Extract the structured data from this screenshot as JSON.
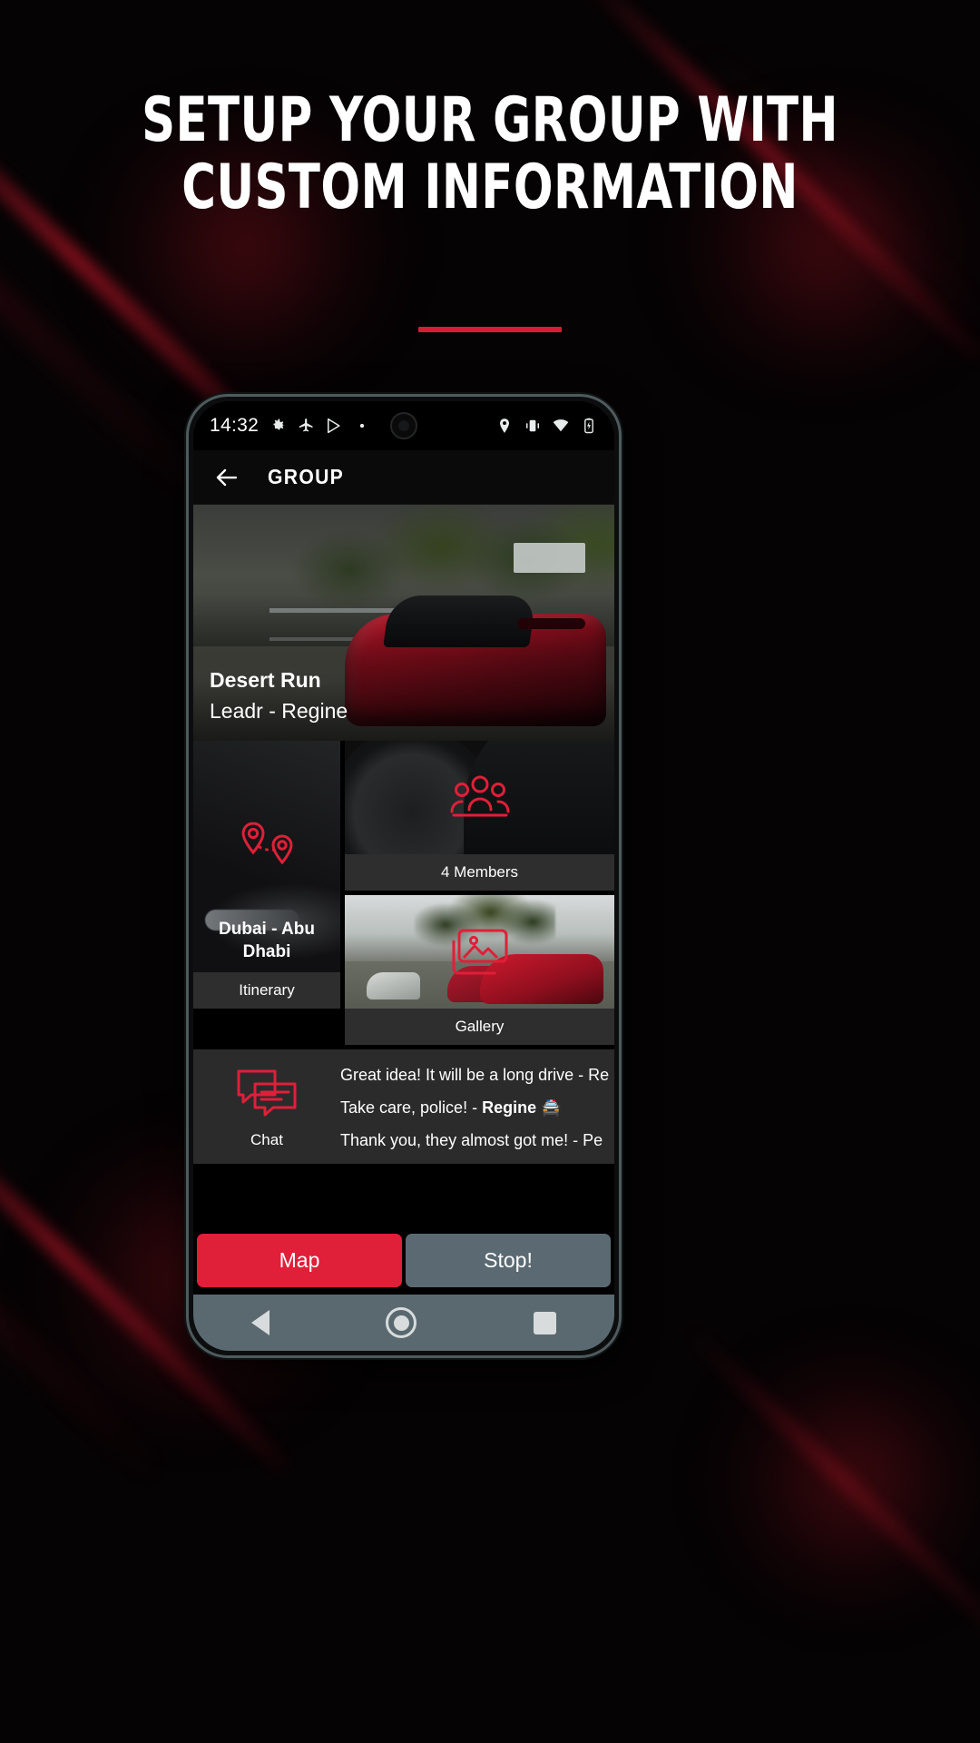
{
  "marketing": {
    "headline_line1": "SETUP YOUR GROUP WITH",
    "headline_line2": "CUSTOM INFORMATION",
    "accent_color": "#d21f35",
    "background_color": "#000000"
  },
  "phone": {
    "status_bar": {
      "time": "14:32",
      "left_icons": [
        "gear-icon",
        "airplane-icon",
        "play-store-icon",
        "dot-icon"
      ],
      "right_icons": [
        "location-icon",
        "vibrate-icon",
        "wifi-icon",
        "battery-icon"
      ]
    },
    "app_bar": {
      "back_label": "back-arrow",
      "title": "GROUP"
    },
    "hero": {
      "group_name": "Desert Run",
      "leader_line": "Leadr - Regine"
    },
    "tiles": [
      {
        "key": "itinerary",
        "icon": "map-pins-icon",
        "overlay_label": "Dubai - Abu Dhabi",
        "caption": "Itinerary"
      },
      {
        "key": "members",
        "icon": "members-group-icon",
        "caption": "4 Members"
      },
      {
        "key": "gallery",
        "icon": "photo-gallery-icon",
        "caption": "Gallery"
      }
    ],
    "chat": {
      "icon": "chat-bubbles-icon",
      "label": "Chat",
      "messages": [
        {
          "text": "Great idea! It will be a long drive - Re",
          "author_bold": false
        },
        {
          "text": "Take care, police! - ",
          "author": "Regine",
          "suffix": " 🚔",
          "author_bold": true
        },
        {
          "text": "Thank you, they almost got me! - Pe",
          "author_bold": false
        }
      ]
    },
    "actions": {
      "primary_label": "Map",
      "secondary_label": "Stop!",
      "primary_color": "#e01f38",
      "secondary_color": "#5b6a72"
    },
    "nav_bar": {
      "back": "nav-back-icon",
      "home": "nav-home-icon",
      "recents": "nav-recents-icon"
    }
  }
}
